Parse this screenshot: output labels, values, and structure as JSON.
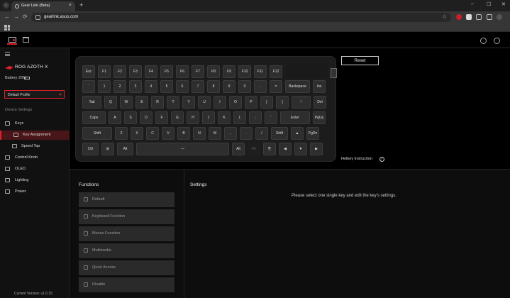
{
  "browser": {
    "tab_title": "Gear Link (Beta)",
    "url": "gearlink.asus.com",
    "new_tab": "+",
    "tab_close": "×",
    "back": "←",
    "forward": "→",
    "reload": "⟳",
    "star": "☆",
    "window_controls": [
      "–",
      "☐",
      "✕"
    ]
  },
  "device": {
    "name": "ROG AZOTH X",
    "battery": "Battery 20%",
    "profile": "Default Profile"
  },
  "sidebar": {
    "section_label": "Device Settings",
    "items": [
      {
        "label": "Keys",
        "sub": false,
        "active": false
      },
      {
        "label": "Key Assignment",
        "sub": true,
        "active": true
      },
      {
        "label": "Speed Tap",
        "sub": true,
        "active": false
      },
      {
        "label": "Control Knob",
        "sub": false,
        "active": false
      },
      {
        "label": "OLED",
        "sub": false,
        "active": false
      },
      {
        "label": "Lighting",
        "sub": false,
        "active": false
      },
      {
        "label": "Power",
        "sub": false,
        "active": false
      }
    ],
    "version": "Current Version: v1.0.15"
  },
  "keyboard": {
    "rows": [
      [
        "Esc",
        "F1",
        "F2",
        "F3",
        "F4",
        "F5",
        "F6",
        "F7",
        "F8",
        "F9",
        "F10",
        "F11",
        "F12"
      ],
      [
        "`",
        "1",
        "2",
        "3",
        "4",
        "5",
        "6",
        "7",
        "8",
        "9",
        "0",
        "-",
        "=",
        "Backspace",
        "Ins"
      ],
      [
        "Tab",
        "Q",
        "W",
        "E",
        "R",
        "T",
        "Y",
        "U",
        "I",
        "O",
        "P",
        "[",
        "]",
        "\\",
        "Del"
      ],
      [
        "Caps",
        "A",
        "S",
        "D",
        "F",
        "G",
        "H",
        "J",
        "K",
        "L",
        ";",
        "'",
        "Enter",
        "PgUp"
      ],
      [
        "Shift",
        "Z",
        "X",
        "C",
        "V",
        "B",
        "N",
        "M",
        ",",
        ".",
        "/",
        "Shift",
        "▲",
        "PgDn"
      ],
      [
        "Ctrl",
        "⊞",
        "Alt",
        "—",
        "Alt",
        "Fn",
        "⎘",
        "◀",
        "▼",
        "▶"
      ]
    ]
  },
  "reset_label": "Reset",
  "hotkey_label": "Hotkey Instruction",
  "info_glyph": "i",
  "functions": {
    "title": "Functions",
    "items": [
      "Default",
      "Keyboard Function",
      "Mouse Function",
      "Multimedia",
      "Quick Access",
      "Disable"
    ]
  },
  "settings": {
    "title": "Settings",
    "message": "Please select one single key and edit the key's settings."
  },
  "colors": {
    "accent": "#e0202a"
  }
}
